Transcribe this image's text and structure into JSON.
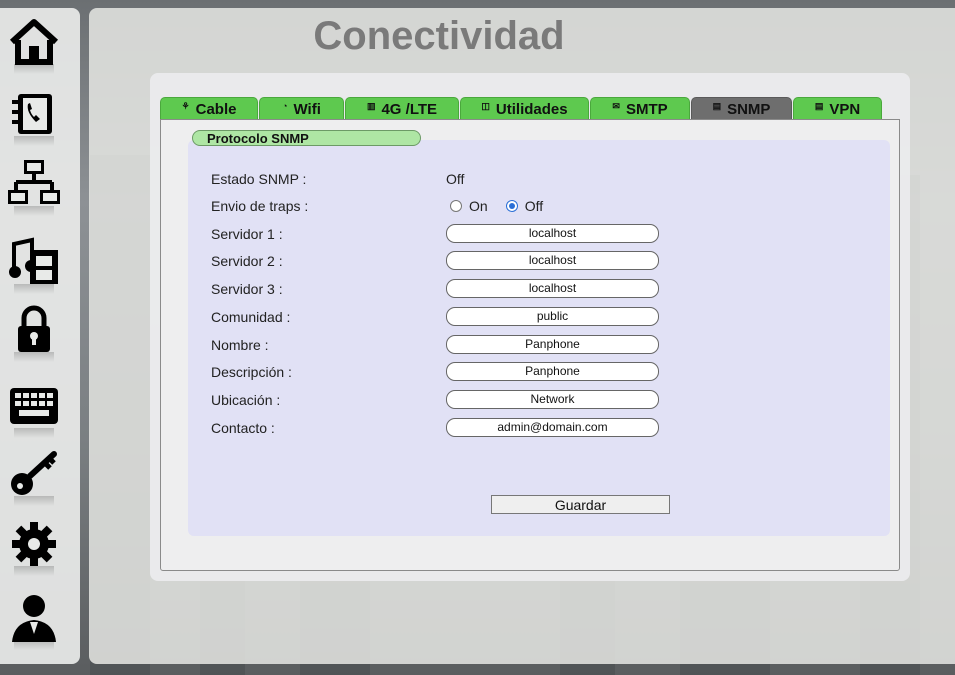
{
  "page_title": "Conectividad",
  "sidebar": {
    "items": [
      {
        "name": "home-icon"
      },
      {
        "name": "phonebook-icon"
      },
      {
        "name": "network-icon"
      },
      {
        "name": "media-icon"
      },
      {
        "name": "lock-icon"
      },
      {
        "name": "keyboard-icon"
      },
      {
        "name": "key-icon"
      },
      {
        "name": "gear-icon"
      },
      {
        "name": "user-icon"
      }
    ]
  },
  "tabs": [
    {
      "label": "Cable",
      "icon": "⚘"
    },
    {
      "label": "Wifi",
      "icon": "◔"
    },
    {
      "label": "4G /LTE",
      "icon": "▥"
    },
    {
      "label": "Utilidades",
      "icon": "◫"
    },
    {
      "label": "SMTP",
      "icon": "✉"
    },
    {
      "label": "SNMP",
      "icon": "▤"
    },
    {
      "label": "VPN",
      "icon": "▤"
    }
  ],
  "section_title": "Protocolo SNMP",
  "form": {
    "estado_label": "Estado SNMP :",
    "estado_value": "Off",
    "traps_label": "Envio de traps :",
    "traps_on": "On",
    "traps_off": "Off",
    "fields": [
      {
        "label": "Servidor 1 :",
        "value": "localhost"
      },
      {
        "label": "Servidor 2 :",
        "value": "localhost"
      },
      {
        "label": "Servidor 3 :",
        "value": "localhost"
      },
      {
        "label": "Comunidad :",
        "value": "public"
      },
      {
        "label": "Nombre :",
        "value": "Panphone"
      },
      {
        "label": "Descripción :",
        "value": "Panphone"
      },
      {
        "label": "Ubicación :",
        "value": "Network"
      },
      {
        "label": "Contacto :",
        "value": "admin@domain.com"
      }
    ],
    "save_label": "Guardar"
  }
}
